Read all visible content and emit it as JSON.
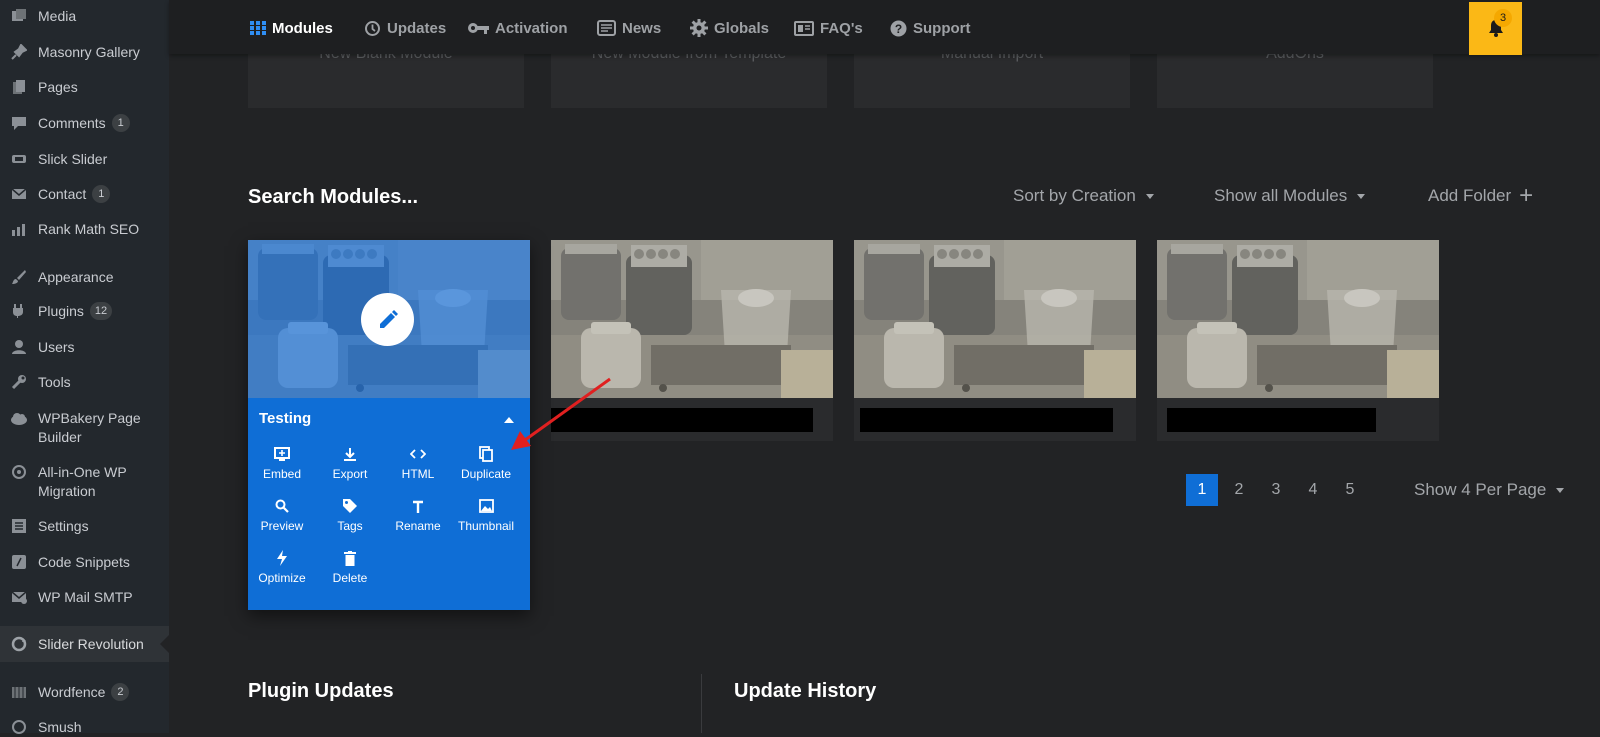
{
  "sidebar": {
    "items": [
      {
        "label": "Media",
        "icon": "media-icon"
      },
      {
        "label": "Masonry Gallery",
        "icon": "pin-icon"
      },
      {
        "label": "Pages",
        "icon": "pages-icon"
      },
      {
        "label": "Comments",
        "badge": "1",
        "icon": "comments-icon"
      },
      {
        "label": "Slick Slider",
        "icon": "slider-icon"
      },
      {
        "label": "Contact",
        "badge": "1",
        "icon": "mail-icon"
      },
      {
        "label": "Rank Math SEO",
        "icon": "chart-icon"
      },
      {
        "label": "Appearance",
        "icon": "brush-icon"
      },
      {
        "label": "Plugins",
        "badge": "12",
        "icon": "plugin-icon"
      },
      {
        "label": "Users",
        "icon": "users-icon"
      },
      {
        "label": "Tools",
        "icon": "wrench-icon"
      },
      {
        "label": "WPBakery Page",
        "label2": "Builder",
        "icon": "cloud-icon"
      },
      {
        "label": "All-in-One WP",
        "label2": "Migration",
        "icon": "migration-icon"
      },
      {
        "label": "Settings",
        "icon": "settings-icon"
      },
      {
        "label": "Code Snippets",
        "icon": "code-icon"
      },
      {
        "label": "WP Mail SMTP",
        "icon": "mail-smtp-icon"
      },
      {
        "label": "Slider Revolution",
        "icon": "revolution-icon",
        "active": true
      },
      {
        "label": "Wordfence",
        "badge": "2",
        "icon": "wordfence-icon"
      },
      {
        "label": "Smush",
        "icon": "smush-icon"
      }
    ]
  },
  "topnav": {
    "items": [
      {
        "label": "Modules",
        "icon": "grid-icon",
        "active": true
      },
      {
        "label": "Updates",
        "icon": "update-icon"
      },
      {
        "label": "Activation",
        "icon": "key-icon"
      },
      {
        "label": "News",
        "icon": "news-icon"
      },
      {
        "label": "Globals",
        "icon": "gear-icon"
      },
      {
        "label": "FAQ's",
        "icon": "faq-icon"
      },
      {
        "label": "Support",
        "icon": "help-icon"
      }
    ],
    "notifications": "3"
  },
  "create_cards": [
    "New Blank Module",
    "New Module from Template",
    "Manual Import",
    "AddOns"
  ],
  "modules": {
    "search_placeholder": "Search Modules...",
    "sort_label": "Sort by Creation",
    "filter_label": "Show all Modules",
    "add_folder_label": "Add Folder",
    "active_module": {
      "title": "Testing",
      "actions": [
        "Embed",
        "Export",
        "HTML",
        "Duplicate",
        "Preview",
        "Tags",
        "Rename",
        "Thumbnail",
        "Optimize",
        "Delete"
      ]
    }
  },
  "pagination": {
    "pages": [
      "1",
      "2",
      "3",
      "4",
      "5"
    ],
    "current": "1",
    "per_page_label": "Show 4 Per Page"
  },
  "bottom": {
    "plugin_updates_title": "Plugin Updates",
    "update_history_title": "Update History"
  },
  "colors": {
    "accent": "#0f6ed6",
    "bell": "#fbb816",
    "annotation_arrow": "#e02020"
  }
}
